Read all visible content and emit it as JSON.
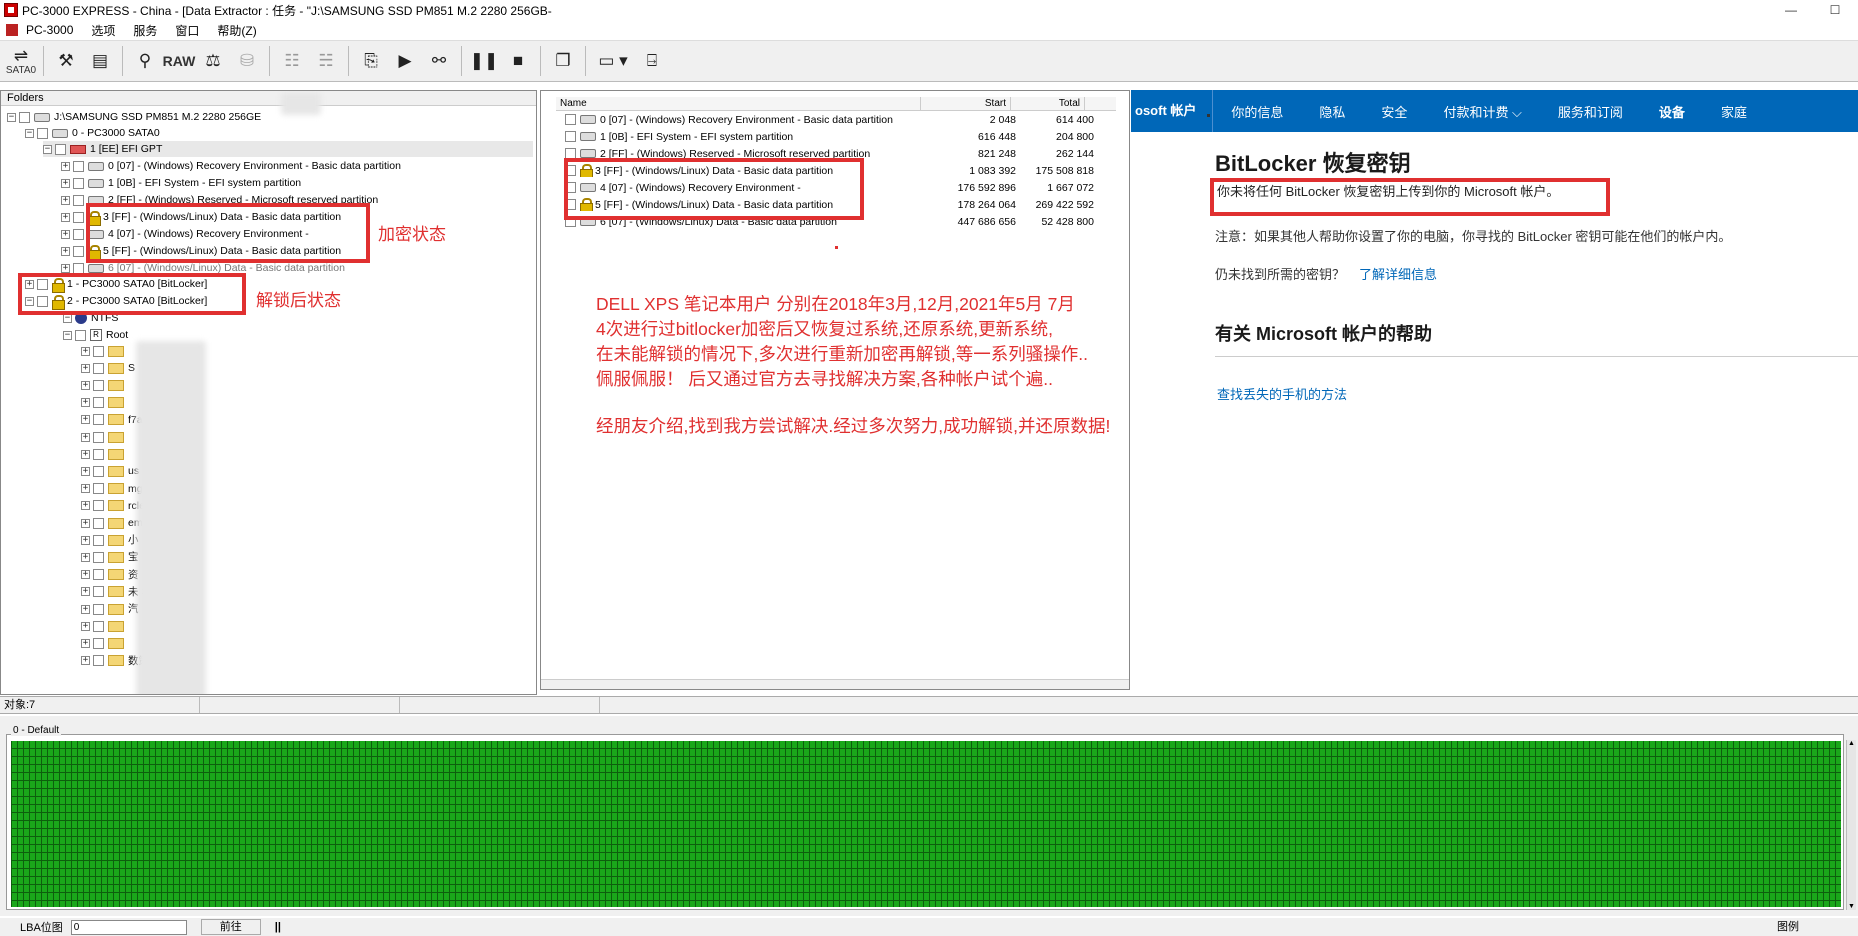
{
  "window": {
    "title": "PC-3000 EXPRESS - China - [Data Extractor : 任务 - \"J:\\SAMSUNG SSD PM851 M.2 2280 256GB-",
    "minimize": "—",
    "maximize": "☐"
  },
  "menu": [
    "PC-3000",
    "选项",
    "服务",
    "窗口",
    "帮助(Z)"
  ],
  "toolbar": {
    "sata_label": "SATA0",
    "raw_label": "RAW"
  },
  "tree": {
    "header": "Folders",
    "disk": "J:\\SAMSUNG SSD PM851 M.2 2280 256GE",
    "sata0": "0 - PC3000 SATA0",
    "gpt": "1 [EE] EFI GPT",
    "partitions": [
      "0 [07] - (Windows) Recovery Environment - Basic data partition",
      "1 [0B] - EFI System - EFI system partition",
      "2 [FF] - (Windows) Reserved - Microsoft reserved partition",
      "3 [FF] - (Windows/Linux) Data - Basic data partition",
      "4 [07] - (Windows) Recovery Environment -",
      "5 [FF] - (Windows/Linux) Data - Basic data partition",
      "6 [07] - (Windows/Linux) Data - Basic data partition"
    ],
    "bitlocker1": "1 - PC3000 SATA0 [BitLocker]",
    "bitlocker2": "2 - PC3000 SATA0 [BitLocker]",
    "ntfs": "NTFS",
    "root": "Root",
    "root_badge": "R",
    "folders": [
      "",
      "S",
      "",
      "",
      "f7a",
      "",
      "",
      "us   me",
      "mg   pro",
      "rcle",
      "em   e Info",
      "小",
      "宝     申请",
      "资",
      "未    3-13",
      "汽",
      "",
      "",
      "  数策"
    ]
  },
  "list": {
    "columns": [
      "Name",
      "Start",
      "Total"
    ],
    "rows": [
      {
        "name": "0 [07] - (Windows) Recovery Environment - Basic data partition",
        "start": "2 048",
        "total": "614 400"
      },
      {
        "name": "1 [0B] - EFI System - EFI system partition",
        "start": "616 448",
        "total": "204 800"
      },
      {
        "name": "2 [FF] - (Windows) Reserved - Microsoft reserved partition",
        "start": "821 248",
        "total": "262 144"
      },
      {
        "name": "3 [FF] - (Windows/Linux) Data - Basic data partition",
        "start": "1 083 392",
        "total": "175 508 818"
      },
      {
        "name": "4 [07] - (Windows) Recovery Environment -",
        "start": "176 592 896",
        "total": "1 667 072"
      },
      {
        "name": "5 [FF] - (Windows/Linux) Data - Basic data partition",
        "start": "178 264 064",
        "total": "269 422 592"
      },
      {
        "name": "6 [07] - (Windows/Linux) Data - Basic data partition",
        "start": "447 686 656",
        "total": "52 428 800"
      }
    ]
  },
  "ms": {
    "brand": "osoft 帐户",
    "nav": [
      "你的信息",
      "隐私",
      "安全",
      "付款和计费 ⌵",
      "服务和订阅",
      "设备",
      "家庭"
    ],
    "heading": "BitLocker 恢复密钥",
    "message": "你未将任何 BitLocker 恢复密钥上传到你的 Microsoft 帐户。",
    "note": "注意：如果其他人帮助你设置了你的电脑，你寻找的 BitLocker 密钥可能在他们的帐户内。",
    "question": "仍未找到所需的密钥？",
    "question_link": "了解详细信息",
    "help_title": "有关 Microsoft 帐户的帮助",
    "help_link": "查找丢失的手机的方法"
  },
  "annotations": {
    "encrypted": "加密状态",
    "unlocked": "解锁后状态",
    "story": [
      "DELL XPS 笔记本用户 分别在2018年3月,12月,2021年5月  7月",
      "4次进行过bitlocker加密后又恢复过系统,还原系统,更新系统,",
      "在未能解锁的情况下,多次进行重新加密再解锁,等一系列骚操作..",
      "佩服佩服！ 后又通过官方去寻找解决方案,各种帐户试个遍..",
      "经朋友介绍,找到我方尝试解决.经过多次努力,成功解锁,并还原数据!"
    ]
  },
  "status": {
    "objects": "对象:7"
  },
  "map": {
    "legend": "0 - Default"
  },
  "bottom": {
    "lba_label": "LBA位图",
    "lba_value": "0",
    "forward": "前往",
    "pause": "||",
    "legend": "图例"
  },
  "colors": {
    "accent": "#0067b8",
    "annotation": "#e03030",
    "map_ok": "#1aa71a"
  }
}
